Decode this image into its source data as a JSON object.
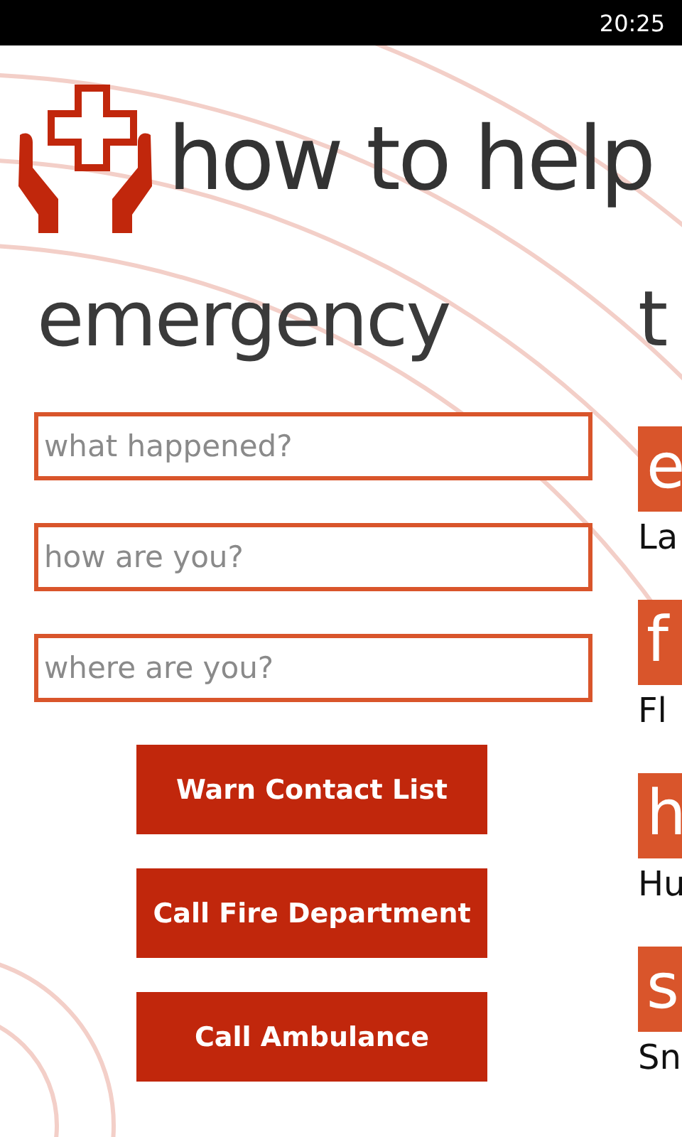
{
  "status_bar": {
    "time": "20:25"
  },
  "header": {
    "title": "how to help"
  },
  "emergency": {
    "title": "emergency",
    "fields": [
      {
        "placeholder": "what happened?"
      },
      {
        "placeholder": "how are you?"
      },
      {
        "placeholder": "where are you?"
      }
    ],
    "buttons": [
      "Warn Contact List",
      "Call Fire Department",
      "Call Ambulance"
    ]
  },
  "next_section": {
    "title": "t",
    "tiles": [
      {
        "letter": "e",
        "label": "La"
      },
      {
        "letter": "f",
        "label": "Fl"
      },
      {
        "letter": "h",
        "label": "Hu"
      },
      {
        "letter": "s",
        "label": "Sn"
      }
    ]
  }
}
